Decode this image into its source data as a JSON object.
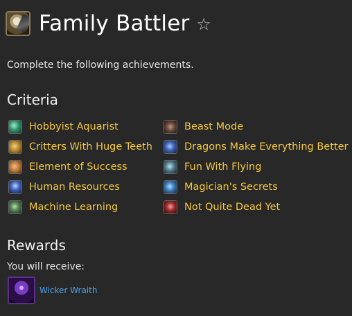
{
  "header": {
    "title": "Family Battler",
    "favorite_icon": "star-outline-icon",
    "achievement_icon": "family-battler-icon"
  },
  "description": "Complete the following achievements.",
  "criteria": {
    "heading": "Criteria",
    "left": [
      {
        "label": "Hobbyist Aquarist",
        "icon": "aquatic-icon",
        "color": "#2f8f6a"
      },
      {
        "label": "Critters With Huge Teeth",
        "icon": "critter-icon",
        "color": "#b88a2e"
      },
      {
        "label": "Element of Success",
        "icon": "elemental-icon",
        "color": "#c07a3a"
      },
      {
        "label": "Human Resources",
        "icon": "humanoid-icon",
        "color": "#3b5fb8"
      },
      {
        "label": "Machine Learning",
        "icon": "mechanical-icon",
        "color": "#4f7a52"
      }
    ],
    "right": [
      {
        "label": "Beast Mode",
        "icon": "beast-icon",
        "color": "#6a4a3a"
      },
      {
        "label": "Dragons Make Everything Better",
        "icon": "dragonkin-icon",
        "color": "#3a62b0"
      },
      {
        "label": "Fun With Flying",
        "icon": "flying-icon",
        "color": "#4e7a8a"
      },
      {
        "label": "Magician's Secrets",
        "icon": "magic-icon",
        "color": "#3a7ab8"
      },
      {
        "label": "Not Quite Dead Yet",
        "icon": "undead-icon",
        "color": "#9a2a2a"
      }
    ]
  },
  "rewards": {
    "heading": "Rewards",
    "receive_text": "You will receive:",
    "item": {
      "label": "Wicker Wraith",
      "icon": "wicker-wraith-icon"
    }
  },
  "colors": {
    "link": "#f5c842",
    "reward_link": "#4aa3f0",
    "background": "#282828"
  }
}
